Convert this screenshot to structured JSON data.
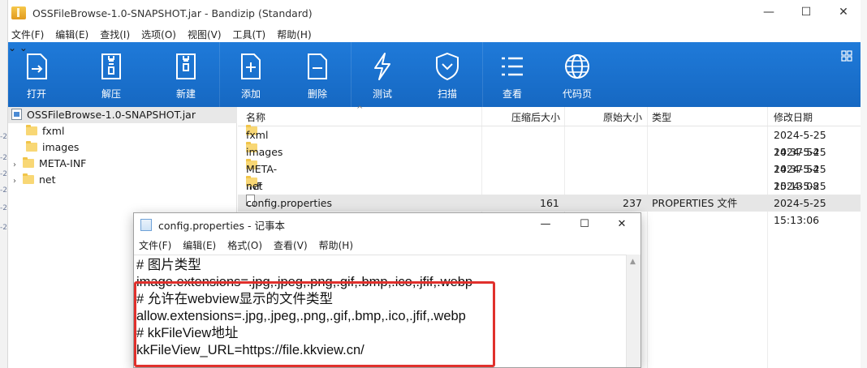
{
  "bandizip": {
    "title": "OSSFileBrowse-1.0-SNAPSHOT.jar - Bandizip (Standard)",
    "window_controls": {
      "minimize": "—",
      "maximize": "☐",
      "close": "✕"
    },
    "menu": [
      "文件(F)",
      "编辑(E)",
      "查找(I)",
      "选项(O)",
      "视图(V)",
      "工具(T)",
      "帮助(H)"
    ],
    "toolbar": {
      "open": "打开",
      "extract": "解压",
      "new": "新建",
      "add": "添加",
      "delete": "删除",
      "test": "测试",
      "scan": "扫描",
      "view": "查看",
      "codepage": "代码页"
    },
    "tree": {
      "root": "OSSFileBrowse-1.0-SNAPSHOT.jar",
      "items": [
        "fxml",
        "images",
        "META-INF",
        "net"
      ]
    },
    "columns": {
      "name": "名称",
      "compressed": "压缩后大小",
      "original": "原始大小",
      "type": "类型",
      "modified": "修改日期"
    },
    "files": [
      {
        "name": "fxml",
        "compressed": "",
        "original": "",
        "type": "",
        "modified": "2024-5-25 14:37:54"
      },
      {
        "name": "images",
        "compressed": "",
        "original": "",
        "type": "",
        "modified": "2024-5-25 14:37:54"
      },
      {
        "name": "META-INF",
        "compressed": "",
        "original": "",
        "type": "",
        "modified": "2024-5-25 15:13:08"
      },
      {
        "name": "net",
        "compressed": "",
        "original": "",
        "type": "",
        "modified": "2024-5-25 14:37:56"
      },
      {
        "name": "config.properties",
        "compressed": "161",
        "original": "237",
        "type": "PROPERTIES 文件",
        "modified": "2024-5-25 15:13:06"
      }
    ]
  },
  "notepad": {
    "title": "config.properties - 记事本",
    "window_controls": {
      "minimize": "—",
      "maximize": "☐",
      "close": "✕"
    },
    "menu": [
      "文件(F)",
      "编辑(E)",
      "格式(O)",
      "查看(V)",
      "帮助(H)"
    ],
    "lines": [
      "# 图片类型",
      "image.extensions=.jpg,.jpeg,.png,.gif,.bmp,.ico,.jfif,.webp",
      "# 允许在webview显示的文件类型",
      "allow.extensions=.jpg,.jpeg,.png,.gif,.bmp,.ico,.jfif,.webp",
      "# kkFileView地址",
      "kkFileView_URL=https://file.kkview.cn/"
    ]
  },
  "colors": {
    "toolbar": "#1a70cc",
    "selection": "#e6e6e6",
    "folder": "#f8d775",
    "highlight": "#e0302c"
  }
}
